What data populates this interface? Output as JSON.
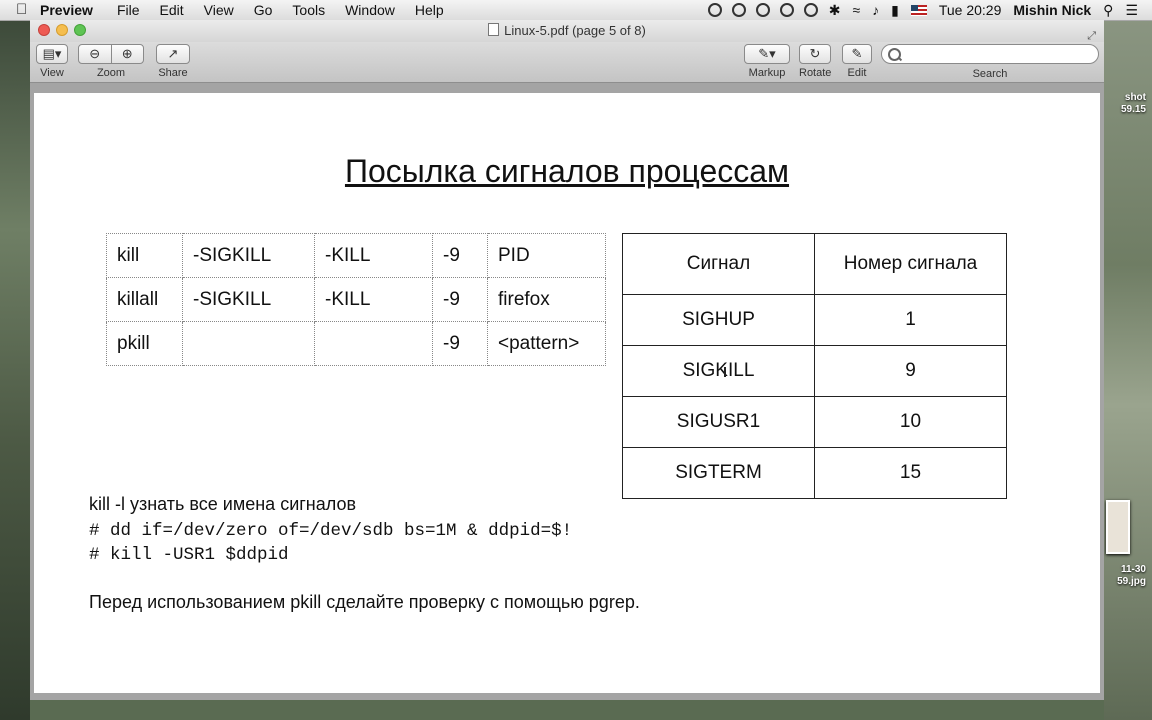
{
  "menubar": {
    "app": "Preview",
    "items": [
      "File",
      "Edit",
      "View",
      "Go",
      "Tools",
      "Window",
      "Help"
    ],
    "clock": "Tue 20:29",
    "user": "Mishin Nick"
  },
  "window": {
    "title": "Linux-5.pdf (page 5 of 8)"
  },
  "toolbar": {
    "view_label": "View",
    "zoom_label": "Zoom",
    "share_label": "Share",
    "markup_label": "Markup",
    "rotate_label": "Rotate",
    "edit_label": "Edit",
    "search_label": "Search",
    "search_placeholder": ""
  },
  "desktop": {
    "file1": "shot\n59.15",
    "file2": "11-30\n59.jpg"
  },
  "slide": {
    "title": "Посылка сигналов процессам",
    "commands": [
      [
        "kill",
        "-SIGKILL",
        "-KILL",
        "-9",
        "PID"
      ],
      [
        "killall",
        "-SIGKILL",
        "-KILL",
        "-9",
        "firefox"
      ],
      [
        "pkill",
        "",
        "",
        "-9",
        "<pattern>"
      ]
    ],
    "signals": {
      "headers": [
        "Сигнал",
        "Номер сигнала"
      ],
      "rows": [
        [
          "SIGHUP",
          "1"
        ],
        [
          "SIGKILL",
          "9"
        ],
        [
          "SIGUSR1",
          "10"
        ],
        [
          "SIGTERM",
          "15"
        ]
      ]
    },
    "note1": "kill -l узнать все имена сигналов",
    "code1": "# dd if=/dev/zero of=/dev/sdb bs=1M & ddpid=$!",
    "code2": "# kill -USR1 $ddpid",
    "note2": "Перед использованием pkill сделайте проверку с помощью pgrep."
  }
}
